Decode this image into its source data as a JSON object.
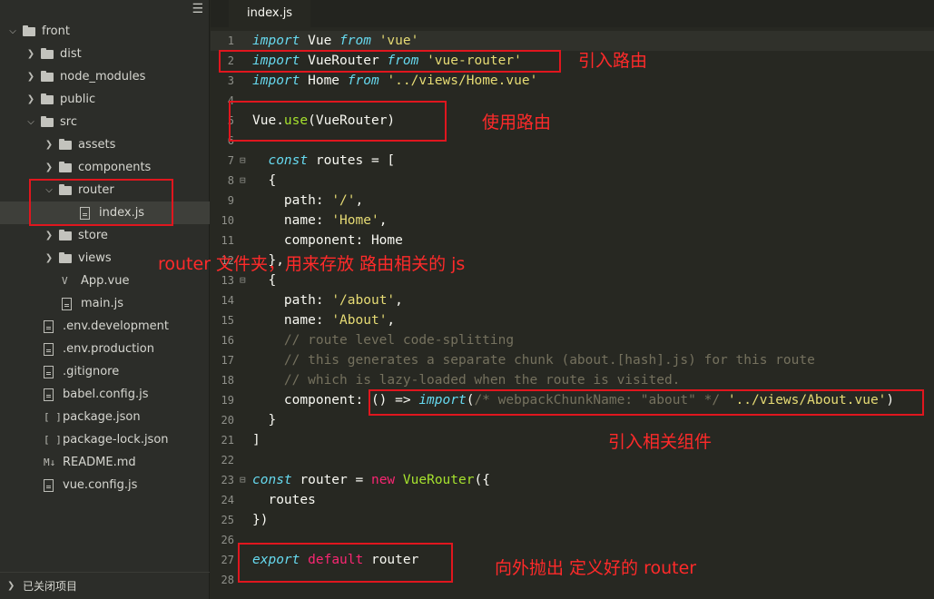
{
  "sidebar": {
    "menu_icon": "hamburger-menu-icon",
    "items": [
      {
        "label": "front",
        "kind": "folder",
        "expanded": true,
        "depth": 0
      },
      {
        "label": "dist",
        "kind": "folder",
        "expanded": false,
        "depth": 1
      },
      {
        "label": "node_modules",
        "kind": "folder",
        "expanded": false,
        "depth": 1
      },
      {
        "label": "public",
        "kind": "folder",
        "expanded": false,
        "depth": 1
      },
      {
        "label": "src",
        "kind": "folder",
        "expanded": true,
        "depth": 1
      },
      {
        "label": "assets",
        "kind": "folder",
        "expanded": false,
        "depth": 2
      },
      {
        "label": "components",
        "kind": "folder",
        "expanded": false,
        "depth": 2
      },
      {
        "label": "router",
        "kind": "folder",
        "expanded": true,
        "depth": 2
      },
      {
        "label": "index.js",
        "kind": "file",
        "depth": 3,
        "selected": true
      },
      {
        "label": "store",
        "kind": "folder",
        "expanded": false,
        "depth": 2
      },
      {
        "label": "views",
        "kind": "folder",
        "expanded": false,
        "depth": 2
      },
      {
        "label": "App.vue",
        "kind": "vue",
        "depth": 2
      },
      {
        "label": "main.js",
        "kind": "file",
        "depth": 2
      },
      {
        "label": ".env.development",
        "kind": "file",
        "depth": 1
      },
      {
        "label": ".env.production",
        "kind": "file",
        "depth": 1
      },
      {
        "label": ".gitignore",
        "kind": "file",
        "depth": 1
      },
      {
        "label": "babel.config.js",
        "kind": "file",
        "depth": 1
      },
      {
        "label": "package.json",
        "kind": "json",
        "depth": 1
      },
      {
        "label": "package-lock.json",
        "kind": "json",
        "depth": 1
      },
      {
        "label": "README.md",
        "kind": "md",
        "depth": 1
      },
      {
        "label": "vue.config.js",
        "kind": "file",
        "depth": 1
      }
    ],
    "footer_label": "已关闭项目"
  },
  "editor": {
    "tab_label": "index.js",
    "current_line": 1,
    "lines": [
      {
        "n": "1",
        "fold": "",
        "tokens": [
          [
            "kwi",
            "import"
          ],
          [
            "pl",
            " Vue "
          ],
          [
            "kwi",
            "from"
          ],
          [
            "pl",
            " "
          ],
          [
            "str",
            "'vue'"
          ]
        ]
      },
      {
        "n": "2",
        "fold": "",
        "tokens": [
          [
            "kwi",
            "import"
          ],
          [
            "pl",
            " VueRouter "
          ],
          [
            "kwi",
            "from"
          ],
          [
            "pl",
            " "
          ],
          [
            "str",
            "'vue-router'"
          ]
        ]
      },
      {
        "n": "3",
        "fold": "",
        "tokens": [
          [
            "kwi",
            "import"
          ],
          [
            "pl",
            " Home "
          ],
          [
            "kwi",
            "from"
          ],
          [
            "pl",
            " "
          ],
          [
            "str",
            "'../views/Home.vue'"
          ]
        ]
      },
      {
        "n": "4",
        "fold": "",
        "tokens": []
      },
      {
        "n": "5",
        "fold": "",
        "tokens": [
          [
            "pl",
            "Vue."
          ],
          [
            "fn",
            "use"
          ],
          [
            "pl",
            "(VueRouter)"
          ]
        ]
      },
      {
        "n": "6",
        "fold": "",
        "tokens": []
      },
      {
        "n": "7",
        "fold": "⊟",
        "tokens": [
          [
            "pl",
            "  "
          ],
          [
            "kwi",
            "const"
          ],
          [
            "pl",
            " routes = ["
          ]
        ]
      },
      {
        "n": "8",
        "fold": "⊟",
        "tokens": [
          [
            "pl",
            "  {"
          ]
        ]
      },
      {
        "n": "9",
        "fold": "",
        "tokens": [
          [
            "pl",
            "    path: "
          ],
          [
            "str",
            "'/'"
          ],
          [
            "pl",
            ","
          ]
        ]
      },
      {
        "n": "10",
        "fold": "",
        "tokens": [
          [
            "pl",
            "    name: "
          ],
          [
            "str",
            "'Home'"
          ],
          [
            "pl",
            ","
          ]
        ]
      },
      {
        "n": "11",
        "fold": "",
        "tokens": [
          [
            "pl",
            "    component: Home"
          ]
        ]
      },
      {
        "n": "12",
        "fold": "",
        "tokens": [
          [
            "pl",
            "  },"
          ]
        ]
      },
      {
        "n": "13",
        "fold": "⊟",
        "tokens": [
          [
            "pl",
            "  {"
          ]
        ]
      },
      {
        "n": "14",
        "fold": "",
        "tokens": [
          [
            "pl",
            "    path: "
          ],
          [
            "str",
            "'/about'"
          ],
          [
            "pl",
            ","
          ]
        ]
      },
      {
        "n": "15",
        "fold": "",
        "tokens": [
          [
            "pl",
            "    name: "
          ],
          [
            "str",
            "'About'"
          ],
          [
            "pl",
            ","
          ]
        ]
      },
      {
        "n": "16",
        "fold": "",
        "tokens": [
          [
            "com",
            "    // route level code-splitting"
          ]
        ]
      },
      {
        "n": "17",
        "fold": "",
        "tokens": [
          [
            "com",
            "    // this generates a separate chunk (about.[hash].js) for this route"
          ]
        ]
      },
      {
        "n": "18",
        "fold": "",
        "tokens": [
          [
            "com",
            "    // which is lazy-loaded when the route is visited."
          ]
        ]
      },
      {
        "n": "19",
        "fold": "",
        "tokens": [
          [
            "pl",
            "    component: () => "
          ],
          [
            "kwi",
            "import"
          ],
          [
            "pl",
            "("
          ],
          [
            "com",
            "/* webpackChunkName: \"about\" */"
          ],
          [
            "pl",
            " "
          ],
          [
            "str",
            "'../views/About.vue'"
          ],
          [
            "pl",
            ")"
          ]
        ]
      },
      {
        "n": "20",
        "fold": "",
        "tokens": [
          [
            "pl",
            "  }"
          ]
        ]
      },
      {
        "n": "21",
        "fold": "",
        "tokens": [
          [
            "pl",
            "]"
          ]
        ]
      },
      {
        "n": "22",
        "fold": "",
        "tokens": []
      },
      {
        "n": "23",
        "fold": "⊟",
        "tokens": [
          [
            "kwi",
            "const"
          ],
          [
            "pl",
            " router = "
          ],
          [
            "kw",
            "new"
          ],
          [
            "pl",
            " "
          ],
          [
            "fn",
            "VueRouter"
          ],
          [
            "pl",
            "({"
          ]
        ]
      },
      {
        "n": "24",
        "fold": "",
        "tokens": [
          [
            "pl",
            "  routes"
          ]
        ]
      },
      {
        "n": "25",
        "fold": "",
        "tokens": [
          [
            "pl",
            "})"
          ]
        ]
      },
      {
        "n": "26",
        "fold": "",
        "tokens": []
      },
      {
        "n": "27",
        "fold": "",
        "tokens": [
          [
            "kwi",
            "export"
          ],
          [
            "pl",
            " "
          ],
          [
            "kw",
            "default"
          ],
          [
            "pl",
            " router"
          ]
        ]
      },
      {
        "n": "28",
        "fold": "",
        "tokens": []
      }
    ]
  },
  "annotations": {
    "import_router": "引入路由",
    "use_router": "使用路由",
    "router_folder": "router 文件夹，用来存放 路由相关的 js",
    "import_component": "引入相关组件",
    "export_router": "向外抛出 定义好的 router"
  },
  "colors": {
    "annotation_red": "#ff2a2a",
    "box_red": "#e0161e",
    "editor_bg": "#272822",
    "sidebar_bg": "#2c2d29"
  }
}
